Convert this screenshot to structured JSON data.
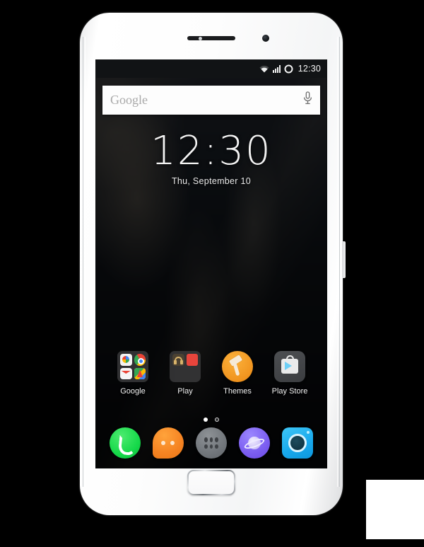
{
  "device": {
    "name": "white-smartphone-front",
    "hardware": {
      "earpiece": "earpiece-speaker",
      "front_camera": "front-camera-lens",
      "proximity_sensor": "proximity-sensor",
      "home_button": "home-button",
      "side_key": "volume-power-key"
    }
  },
  "screen": {
    "status_bar": {
      "wifi_icon": "wifi-icon",
      "signal_icon": "cellular-signal-icon",
      "battery_icon": "battery-circle-icon",
      "time": "12:30"
    },
    "search": {
      "widget_name": "google-search-widget",
      "placeholder": "Google",
      "mic_icon": "microphone-icon"
    },
    "clock_widget": {
      "time": "12:30",
      "date": "Thu, September 10"
    },
    "apps": [
      {
        "label": "Google",
        "type": "folder",
        "contents": [
          "google-search",
          "chrome",
          "gmail",
          "maps"
        ]
      },
      {
        "label": "Play",
        "type": "folder",
        "contents": [
          "play-music",
          "play-movies"
        ]
      },
      {
        "label": "Themes",
        "type": "app",
        "icon": "paint-roller-icon",
        "accent": "#f0941f"
      },
      {
        "label": "Play Store",
        "type": "app",
        "icon": "play-store-bag-icon",
        "accent": "#434548"
      }
    ],
    "page_indicator": {
      "count": 2,
      "active_index": 0
    },
    "dock": [
      {
        "label": "Phone",
        "icon": "phone-handset-icon",
        "accent": "#16d94a"
      },
      {
        "label": "Messages",
        "icon": "speech-bubble-icon",
        "accent": "#f58322"
      },
      {
        "label": "Apps",
        "icon": "app-drawer-dots-icon",
        "accent": "#6f7479"
      },
      {
        "label": "Browser",
        "icon": "planet-icon",
        "accent": "#7a5cf0"
      },
      {
        "label": "Camera",
        "icon": "camera-lens-icon",
        "accent": "#18a8ec"
      }
    ]
  },
  "overlay": {
    "corner_swatch": "blank-white-square"
  }
}
